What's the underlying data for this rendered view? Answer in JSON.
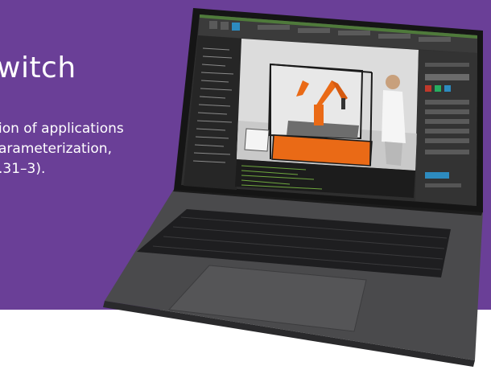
{
  "banner": {
    "headline": "witch",
    "body_lines": [
      "ion of applications",
      "arameterization,",
      ".31–3)."
    ]
  },
  "screen": {
    "ribbon_title": "",
    "code_lines": [
      "-------------------------",
      "-------------------------",
      "-------------------------",
      "-------------------------",
      "-------------------------",
      "-------------------------",
      "-------------------------",
      "-------------------------"
    ]
  },
  "colors": {
    "banner_purple": "#6a3f97",
    "laptop_body": "#3a3a3c",
    "screen_dark": "#2b2b2b",
    "robot_orange": "#ea6a16",
    "cell_frame": "#1a1a1a"
  },
  "icons": [
    "laptop",
    "robot-arm",
    "human-figure",
    "trackpad",
    "keyboard"
  ]
}
